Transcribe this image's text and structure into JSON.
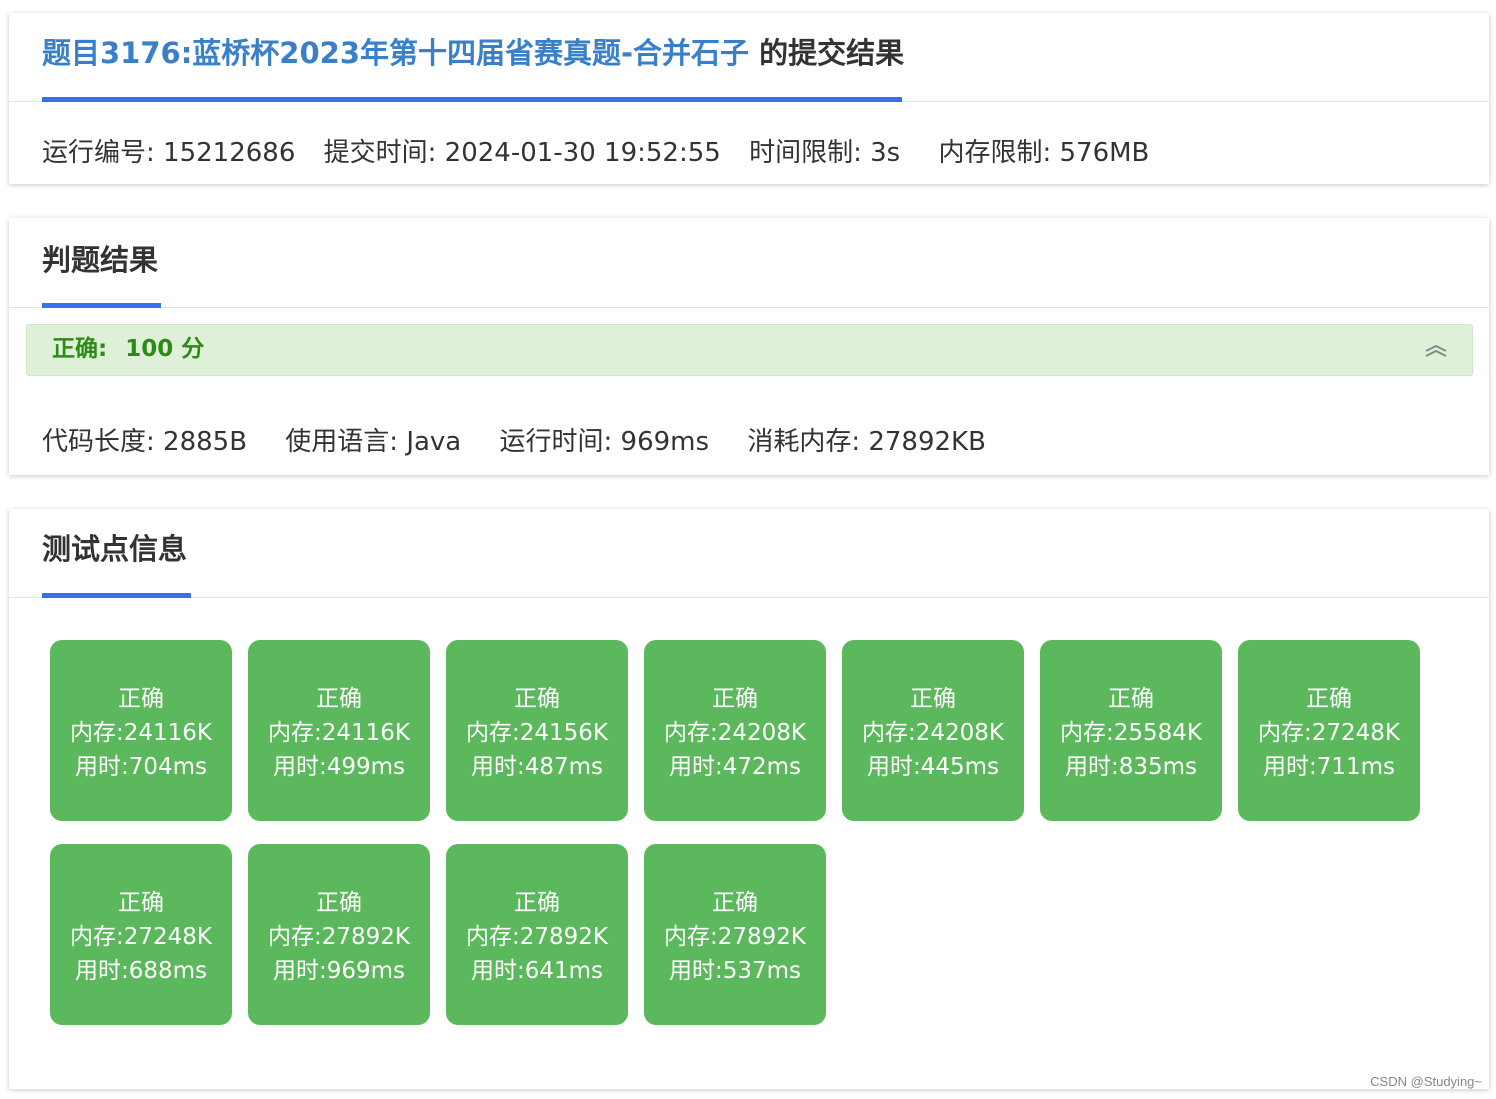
{
  "header": {
    "problem_link": "题目3176:蓝桥杯2023年第十四届省赛真题-合并石子",
    "title_suffix": " 的提交结果",
    "run_id": "运行编号: 15212686",
    "submit_time": "提交时间: 2024-01-30 19:52:55",
    "time_limit": "时间限制: 3s",
    "memory_limit": "内存限制: 576MB"
  },
  "judge": {
    "title": "判题结果",
    "status": "正确:",
    "score": "100 分",
    "code_length": "代码长度: 2885B",
    "language": "使用语言: Java",
    "run_time": "运行时间: 969ms",
    "memory_used": "消耗内存: 27892KB"
  },
  "tests": {
    "title": "测试点信息",
    "items": [
      {
        "status": "正确",
        "memory": "内存:24116K",
        "time": "用时:704ms"
      },
      {
        "status": "正确",
        "memory": "内存:24116K",
        "time": "用时:499ms"
      },
      {
        "status": "正确",
        "memory": "内存:24156K",
        "time": "用时:487ms"
      },
      {
        "status": "正确",
        "memory": "内存:24208K",
        "time": "用时:472ms"
      },
      {
        "status": "正确",
        "memory": "内存:24208K",
        "time": "用时:445ms"
      },
      {
        "status": "正确",
        "memory": "内存:25584K",
        "time": "用时:835ms"
      },
      {
        "status": "正确",
        "memory": "内存:27248K",
        "time": "用时:711ms"
      },
      {
        "status": "正确",
        "memory": "内存:27248K",
        "time": "用时:688ms"
      },
      {
        "status": "正确",
        "memory": "内存:27892K",
        "time": "用时:969ms"
      },
      {
        "status": "正确",
        "memory": "内存:27892K",
        "time": "用时:641ms"
      },
      {
        "status": "正确",
        "memory": "内存:27892K",
        "time": "用时:537ms"
      }
    ]
  },
  "watermark": "CSDN @Studying~",
  "colors": {
    "accent_blue": "#3b6ff2",
    "link_blue": "#3a80c9",
    "success_green": "#5cb85c",
    "success_bg": "#dff0d8",
    "success_text": "#2e8b1a"
  },
  "icons": {
    "collapse": "chevron-double-up-icon"
  }
}
